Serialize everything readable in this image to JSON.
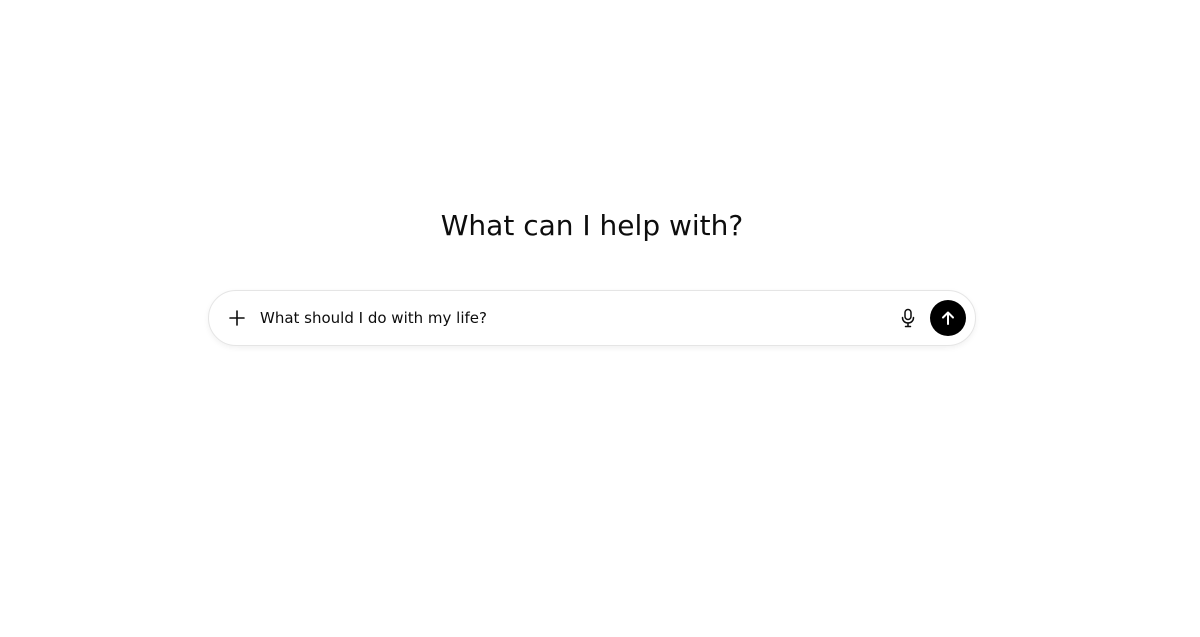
{
  "main": {
    "heading": "What can I help with?"
  },
  "composer": {
    "input_value": "What should I do with my life?",
    "add_icon": "plus-icon",
    "voice_icon": "microphone-icon",
    "send_icon": "arrow-up-icon",
    "send_button_color": "#000000"
  }
}
